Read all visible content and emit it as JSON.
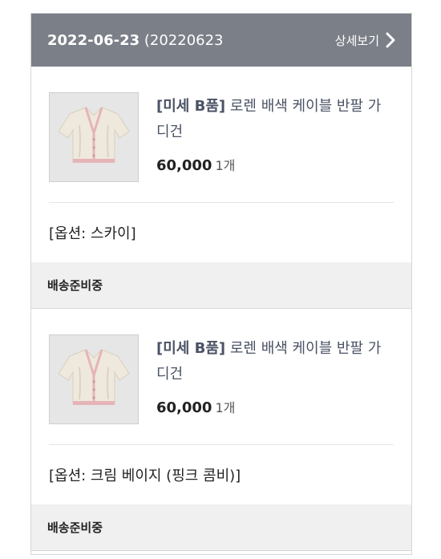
{
  "order": {
    "date": "2022-06-23",
    "number_prefix": " (20220623",
    "detail_label": "상세보기"
  },
  "items": [
    {
      "title_tag": "[미세 B품]",
      "title_rest": " 로렌 배색 케이블 반팔 가디건",
      "price": "60,000",
      "qty": "1개",
      "option": "[옵션: 스카이]",
      "status": "배송준비중"
    },
    {
      "title_tag": "[미세 B품]",
      "title_rest": " 로렌 배색 케이블 반팔 가디건",
      "price": "60,000",
      "qty": "1개",
      "option": "[옵션: 크림 베이지 (핑크 콤비)]",
      "status": "배송준비중"
    }
  ],
  "colors": {
    "header_bg": "#7b7f88",
    "status_bg": "#f0f0f0",
    "title_text": "#4a5264"
  }
}
